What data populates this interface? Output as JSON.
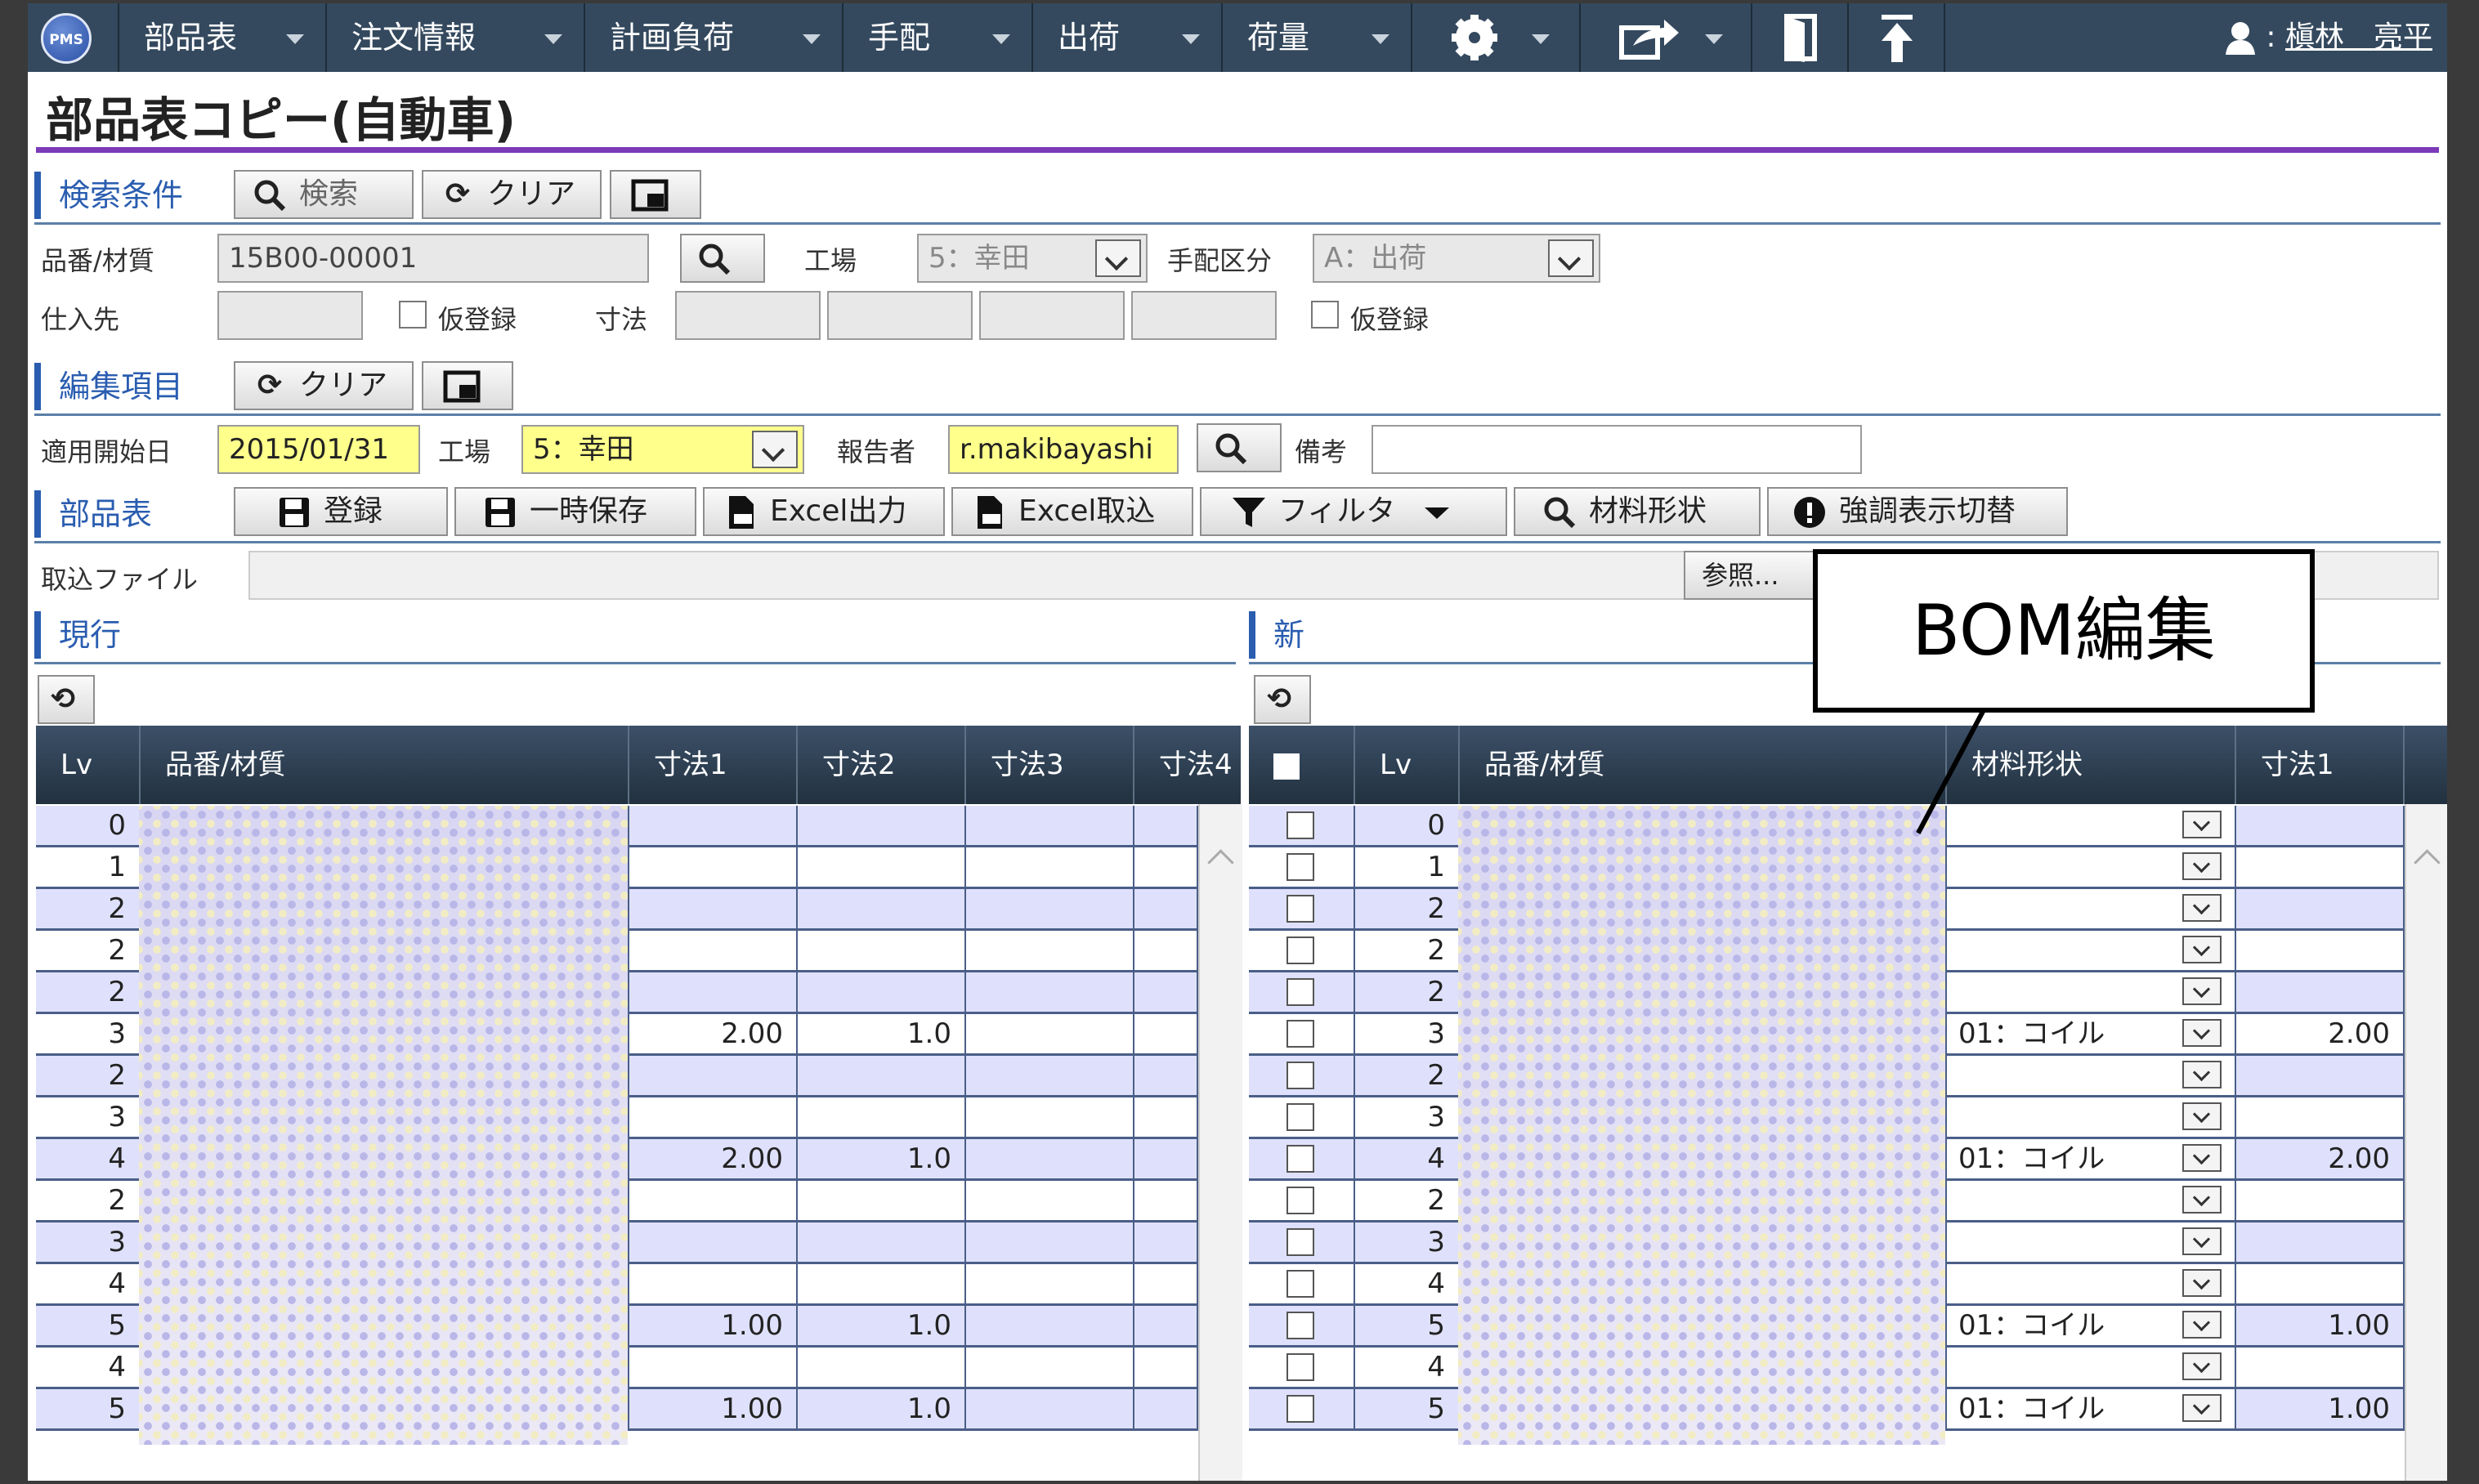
{
  "nav": {
    "logo": "PMS",
    "items": [
      "部品表",
      "注文情報",
      "計画負荷",
      "手配",
      "出荷",
      "荷量"
    ],
    "user_icon": "user-icon",
    "user_prefix": ":",
    "user_name": "槇林　亮平"
  },
  "page": {
    "title": "部品表コピー(自動車)"
  },
  "search": {
    "section_label": "検索条件",
    "search_button": "検索",
    "clear_button": "クリア",
    "part_label": "品番/材質",
    "part_value": "15B00-00001",
    "factory_label": "工場",
    "factory_value": "5：幸田",
    "arrange_label": "手配区分",
    "arrange_value": "A：出荷",
    "supplier_label": "仕入先",
    "provisional_label": "仮登録",
    "dimension_label": "寸法",
    "provisional_label_2": "仮登録"
  },
  "edit": {
    "section_label": "編集項目",
    "clear_button": "クリア",
    "start_date_label": "適用開始日",
    "start_date_value": "2015/01/31",
    "factory_label": "工場",
    "factory_value": "5：幸田",
    "reporter_label": "報告者",
    "reporter_value": "r.makibayashi",
    "note_label": "備考",
    "note_value": ""
  },
  "bom": {
    "section_label": "部品表",
    "register_button": "登録",
    "temp_save_button": "一時保存",
    "excel_out_button": "Excel出力",
    "excel_in_button": "Excel取込",
    "filter_button": "フィルタ",
    "material_shape_button": "材料形状",
    "highlight_button": "強調表示切替",
    "import_file_label": "取込ファイル",
    "browse_button": "参照..."
  },
  "current": {
    "label": "現行",
    "columns": [
      "Lv",
      "品番/材質",
      "寸法1",
      "寸法2",
      "寸法3",
      "寸法4"
    ],
    "rows": [
      {
        "lv": "0",
        "d1": "",
        "d2": ""
      },
      {
        "lv": "1",
        "d1": "",
        "d2": ""
      },
      {
        "lv": "2",
        "d1": "",
        "d2": ""
      },
      {
        "lv": "2",
        "d1": "",
        "d2": ""
      },
      {
        "lv": "2",
        "d1": "",
        "d2": ""
      },
      {
        "lv": "3",
        "d1": "2.00",
        "d2": "1.0"
      },
      {
        "lv": "2",
        "d1": "",
        "d2": ""
      },
      {
        "lv": "3",
        "d1": "",
        "d2": ""
      },
      {
        "lv": "4",
        "d1": "2.00",
        "d2": "1.0"
      },
      {
        "lv": "2",
        "d1": "",
        "d2": ""
      },
      {
        "lv": "3",
        "d1": "",
        "d2": ""
      },
      {
        "lv": "4",
        "d1": "",
        "d2": ""
      },
      {
        "lv": "5",
        "d1": "1.00",
        "d2": "1.0"
      },
      {
        "lv": "4",
        "d1": "",
        "d2": ""
      },
      {
        "lv": "5",
        "d1": "1.00",
        "d2": "1.0"
      }
    ]
  },
  "new": {
    "label": "新",
    "columns": [
      "Lv",
      "品番/材質",
      "材料形状",
      "寸法1"
    ],
    "rows": [
      {
        "lv": "0",
        "shape": "",
        "d1": ""
      },
      {
        "lv": "1",
        "shape": "",
        "d1": ""
      },
      {
        "lv": "2",
        "shape": "",
        "d1": ""
      },
      {
        "lv": "2",
        "shape": "",
        "d1": ""
      },
      {
        "lv": "2",
        "shape": "",
        "d1": ""
      },
      {
        "lv": "3",
        "shape": "01：コイル",
        "d1": "2.00"
      },
      {
        "lv": "2",
        "shape": "",
        "d1": ""
      },
      {
        "lv": "3",
        "shape": "",
        "d1": ""
      },
      {
        "lv": "4",
        "shape": "01：コイル",
        "d1": "2.00"
      },
      {
        "lv": "2",
        "shape": "",
        "d1": ""
      },
      {
        "lv": "3",
        "shape": "",
        "d1": ""
      },
      {
        "lv": "4",
        "shape": "",
        "d1": ""
      },
      {
        "lv": "5",
        "shape": "01：コイル",
        "d1": "1.00"
      },
      {
        "lv": "4",
        "shape": "",
        "d1": ""
      },
      {
        "lv": "5",
        "shape": "01：コイル",
        "d1": "1.00"
      }
    ]
  },
  "callout": {
    "text": "BOM編集"
  },
  "colors": {
    "nav": "#34495e",
    "accent_rule": "#7c3ab8",
    "section": "#2a5db0",
    "odd_row": "#dfe1fc",
    "highlight": "#ffff8c"
  }
}
